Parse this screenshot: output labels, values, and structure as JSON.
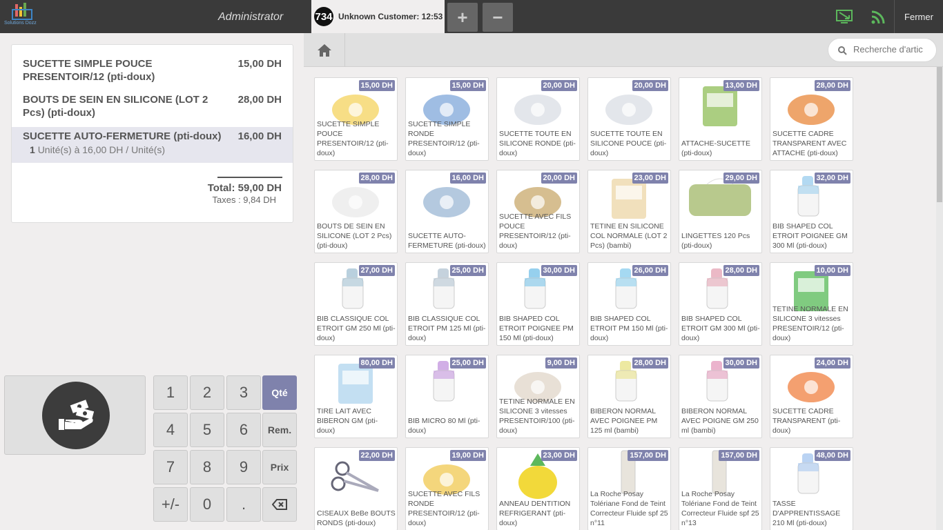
{
  "header": {
    "logo_text": "Solutions Dozz",
    "user": "Administrator",
    "order_number": "734",
    "order_label": "Unknown Customer: 12:53",
    "add_symbol": "+",
    "remove_symbol": "−",
    "close_label": "Fermer",
    "icons": [
      "screen-icon",
      "wifi-icon"
    ],
    "accent_color": "#5cb85c"
  },
  "order": {
    "lines": [
      {
        "name": "SUCETTE SIMPLE POUCE PRESENTOIR/12 (pti-doux)",
        "price": "15,00 DH"
      },
      {
        "name": "BOUTS DE SEIN EN SILICONE (LOT 2 Pcs) (pti-doux)",
        "price": "28,00 DH"
      },
      {
        "name": "SUCETTE AUTO-FERMETURE (pti-doux)",
        "price": "16,00 DH",
        "qty": "1",
        "detail": "Unité(s) à 16,00 DH / Unité(s)"
      }
    ],
    "total": "Total: 59,00 DH",
    "taxes": "Taxes : 9,84 DH"
  },
  "numpad": {
    "keys": [
      "1",
      "2",
      "3",
      "4",
      "5",
      "6",
      "7",
      "8",
      "9",
      "+/-",
      "0",
      "."
    ],
    "modes": [
      "Qté",
      "Rem.",
      "Prix"
    ],
    "active_mode": "Qté",
    "active_color": "#7f82ac"
  },
  "search": {
    "placeholder": "Recherche d'artic"
  },
  "products": [
    {
      "name": "SUCETTE SIMPLE POUCE PRESENTOIR/12 (pti-doux)",
      "price": "15,00 DH"
    },
    {
      "name": "SUCETTE SIMPLE RONDE PRESENTOIR/12 (pti-doux)",
      "price": "15,00 DH"
    },
    {
      "name": "SUCETTE TOUTE EN SILICONE RONDE (pti-doux)",
      "price": "20,00 DH"
    },
    {
      "name": "SUCETTE TOUTE EN SILICONE POUCE (pti-doux)",
      "price": "20,00 DH"
    },
    {
      "name": "ATTACHE-SUCETTE (pti-doux)",
      "price": "13,00 DH"
    },
    {
      "name": "SUCETTE CADRE TRANSPARENT AVEC ATTACHE (pti-doux)",
      "price": "28,00 DH"
    },
    {
      "name": "BOUTS DE SEIN EN SILICONE (LOT 2 Pcs) (pti-doux)",
      "price": "28,00 DH"
    },
    {
      "name": "SUCETTE AUTO-FERMETURE (pti-doux)",
      "price": "16,00 DH"
    },
    {
      "name": "SUCETTE AVEC FILS POUCE PRESENTOIR/12 (pti-doux)",
      "price": "20,00 DH"
    },
    {
      "name": "TETINE EN SILICONE COL NORMALE (LOT 2 Pcs) (bambi)",
      "price": "23,00 DH"
    },
    {
      "name": "LINGETTES 120 Pcs (pti-doux)",
      "price": "29,00 DH"
    },
    {
      "name": "BIB SHAPED COL ETROIT POIGNEE GM 300 Ml (pti-doux)",
      "price": "32,00 DH"
    },
    {
      "name": "BIB CLASSIQUE COL ETROIT GM 250 Ml (pti-doux)",
      "price": "27,00 DH"
    },
    {
      "name": "BIB CLASSIQUE COL ETROIT PM 125 Ml (pti-doux)",
      "price": "25,00 DH"
    },
    {
      "name": "BIB SHAPED COL ETROIT POIGNEE PM 150 Ml (pti-doux)",
      "price": "30,00 DH"
    },
    {
      "name": "BIB SHAPED COL ETROIT PM 150 Ml (pti-doux)",
      "price": "26,00 DH"
    },
    {
      "name": "BIB SHAPED COL ETROIT GM 300 Ml (pti-doux)",
      "price": "28,00 DH"
    },
    {
      "name": "TETINE NORMALE EN SILICONE 3 vitesses PRESENTOIR/12 (pti-doux)",
      "price": "10,00 DH"
    },
    {
      "name": "TIRE LAIT AVEC BIBERON GM (pti-doux)",
      "price": "80,00 DH"
    },
    {
      "name": "BIB MICRO 80 Ml (pti-doux)",
      "price": "25,00 DH"
    },
    {
      "name": "TETINE NORMALE EN SILICONE 3 vitesses PRESENTOIR/100 (pti-doux)",
      "price": "9,00 DH"
    },
    {
      "name": "BIBERON NORMAL AVEC POIGNEE PM 125 ml (bambi)",
      "price": "28,00 DH"
    },
    {
      "name": "BIBERON NORMAL AVEC POIGNE GM 250 ml (bambi)",
      "price": "30,00 DH"
    },
    {
      "name": "SUCETTE CADRE TRANSPARENT (pti-doux)",
      "price": "24,00 DH"
    },
    {
      "name": "CISEAUX BeBe BOUTS RONDS (pti-doux)",
      "price": "22,00 DH"
    },
    {
      "name": "SUCETTE AVEC FILS RONDE PRESENTOIR/12 (pti-doux)",
      "price": "19,00 DH"
    },
    {
      "name": "ANNEAU DENTITION REFRIGERANT (pti-doux)",
      "price": "23,00 DH"
    },
    {
      "name": "La Roche Posay Tolériane Fond de Teint Correcteur Fluide spf 25 n°11",
      "price": "157,00 DH"
    },
    {
      "name": "La Roche Posay Tolériane Fond de Teint Correcteur Fluide spf 25 n°13",
      "price": "157,00 DH"
    },
    {
      "name": "TASSE D'APPRENTISSAGE 210 Ml (pti-doux)",
      "price": "48,00 DH"
    }
  ]
}
